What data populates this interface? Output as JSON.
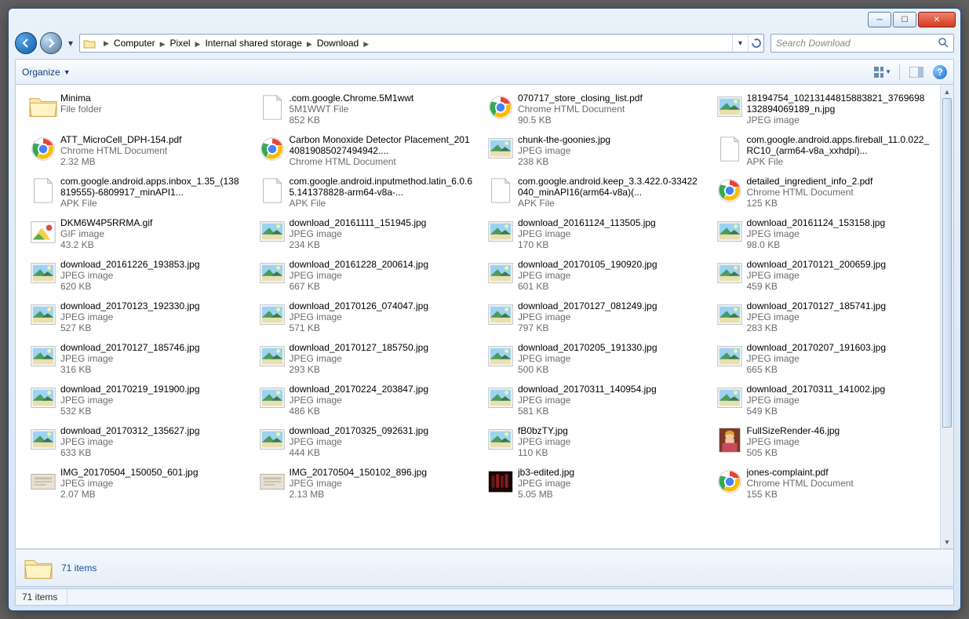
{
  "search": {
    "placeholder": "Search Download"
  },
  "toolbar": {
    "organize": "Organize"
  },
  "breadcrumb": [
    "Computer",
    "Pixel",
    "Internal shared storage",
    "Download"
  ],
  "detail": {
    "label": "71 items"
  },
  "status": {
    "text": "71 items"
  },
  "files": [
    {
      "name": "Minima",
      "type": "File folder",
      "size": "",
      "icon": "folder"
    },
    {
      "name": ".com.google.Chrome.5M1wwt",
      "type": "5M1WWT File",
      "size": "852 KB",
      "icon": "blank"
    },
    {
      "name": "070717_store_closing_list.pdf",
      "type": "Chrome HTML Document",
      "size": "90.5 KB",
      "icon": "chrome"
    },
    {
      "name": "18194754_10213144815883821_3769698132894069189_n.jpg",
      "type": "JPEG image",
      "size": "",
      "icon": "image"
    },
    {
      "name": "ATT_MicroCell_DPH-154.pdf",
      "type": "Chrome HTML Document",
      "size": "2.32 MB",
      "icon": "chrome"
    },
    {
      "name": "Carbon Monoxide Detector Placement_20140819085027494942....",
      "type": "Chrome HTML Document",
      "size": "",
      "icon": "chrome"
    },
    {
      "name": "chunk-the-goonies.jpg",
      "type": "JPEG image",
      "size": "238 KB",
      "icon": "image"
    },
    {
      "name": "com.google.android.apps.fireball_11.0.022_RC10_(arm64-v8a_xxhdpi)...",
      "type": "APK File",
      "size": "",
      "icon": "blank"
    },
    {
      "name": "com.google.android.apps.inbox_1.35_(138819555)-6809917_minAPI1...",
      "type": "APK File",
      "size": "",
      "icon": "blank"
    },
    {
      "name": "com.google.android.inputmethod.latin_6.0.65.141378828-arm64-v8a-...",
      "type": "APK File",
      "size": "",
      "icon": "blank"
    },
    {
      "name": "com.google.android.keep_3.3.422.0-33422040_minAPI16(arm64-v8a)(...",
      "type": "APK File",
      "size": "",
      "icon": "blank"
    },
    {
      "name": "detailed_ingredient_info_2.pdf",
      "type": "Chrome HTML Document",
      "size": "125 KB",
      "icon": "chrome"
    },
    {
      "name": "DKM6W4P5RRMA.gif",
      "type": "GIF image",
      "size": "43.2 KB",
      "icon": "gif"
    },
    {
      "name": "download_20161111_151945.jpg",
      "type": "JPEG image",
      "size": "234 KB",
      "icon": "image"
    },
    {
      "name": "download_20161124_113505.jpg",
      "type": "JPEG image",
      "size": "170 KB",
      "icon": "image"
    },
    {
      "name": "download_20161124_153158.jpg",
      "type": "JPEG image",
      "size": "98.0 KB",
      "icon": "image"
    },
    {
      "name": "download_20161226_193853.jpg",
      "type": "JPEG image",
      "size": "620 KB",
      "icon": "image"
    },
    {
      "name": "download_20161228_200614.jpg",
      "type": "JPEG image",
      "size": "667 KB",
      "icon": "image"
    },
    {
      "name": "download_20170105_190920.jpg",
      "type": "JPEG image",
      "size": "601 KB",
      "icon": "image"
    },
    {
      "name": "download_20170121_200659.jpg",
      "type": "JPEG image",
      "size": "459 KB",
      "icon": "image"
    },
    {
      "name": "download_20170123_192330.jpg",
      "type": "JPEG image",
      "size": "527 KB",
      "icon": "image"
    },
    {
      "name": "download_20170126_074047.jpg",
      "type": "JPEG image",
      "size": "571 KB",
      "icon": "image"
    },
    {
      "name": "download_20170127_081249.jpg",
      "type": "JPEG image",
      "size": "797 KB",
      "icon": "image"
    },
    {
      "name": "download_20170127_185741.jpg",
      "type": "JPEG image",
      "size": "283 KB",
      "icon": "image"
    },
    {
      "name": "download_20170127_185746.jpg",
      "type": "JPEG image",
      "size": "316 KB",
      "icon": "image"
    },
    {
      "name": "download_20170127_185750.jpg",
      "type": "JPEG image",
      "size": "293 KB",
      "icon": "image"
    },
    {
      "name": "download_20170205_191330.jpg",
      "type": "JPEG image",
      "size": "500 KB",
      "icon": "image"
    },
    {
      "name": "download_20170207_191603.jpg",
      "type": "JPEG image",
      "size": "665 KB",
      "icon": "image"
    },
    {
      "name": "download_20170219_191900.jpg",
      "type": "JPEG image",
      "size": "532 KB",
      "icon": "image"
    },
    {
      "name": "download_20170224_203847.jpg",
      "type": "JPEG image",
      "size": "486 KB",
      "icon": "image"
    },
    {
      "name": "download_20170311_140954.jpg",
      "type": "JPEG image",
      "size": "581 KB",
      "icon": "image"
    },
    {
      "name": "download_20170311_141002.jpg",
      "type": "JPEG image",
      "size": "549 KB",
      "icon": "image"
    },
    {
      "name": "download_20170312_135627.jpg",
      "type": "JPEG image",
      "size": "633 KB",
      "icon": "image"
    },
    {
      "name": "download_20170325_092631.jpg",
      "type": "JPEG image",
      "size": "444 KB",
      "icon": "image"
    },
    {
      "name": "fB0bzTY.jpg",
      "type": "JPEG image",
      "size": "110 KB",
      "icon": "image"
    },
    {
      "name": "FullSizeRender-46.jpg",
      "type": "JPEG image",
      "size": "505 KB",
      "icon": "photo1"
    },
    {
      "name": "IMG_20170504_150050_601.jpg",
      "type": "JPEG image",
      "size": "2.07 MB",
      "icon": "photo2"
    },
    {
      "name": "IMG_20170504_150102_896.jpg",
      "type": "JPEG image",
      "size": "2.13 MB",
      "icon": "photo2"
    },
    {
      "name": "jb3-edited.jpg",
      "type": "JPEG image",
      "size": "5.05 MB",
      "icon": "photo3"
    },
    {
      "name": "jones-complaint.pdf",
      "type": "Chrome HTML Document",
      "size": "155 KB",
      "icon": "chrome"
    }
  ]
}
